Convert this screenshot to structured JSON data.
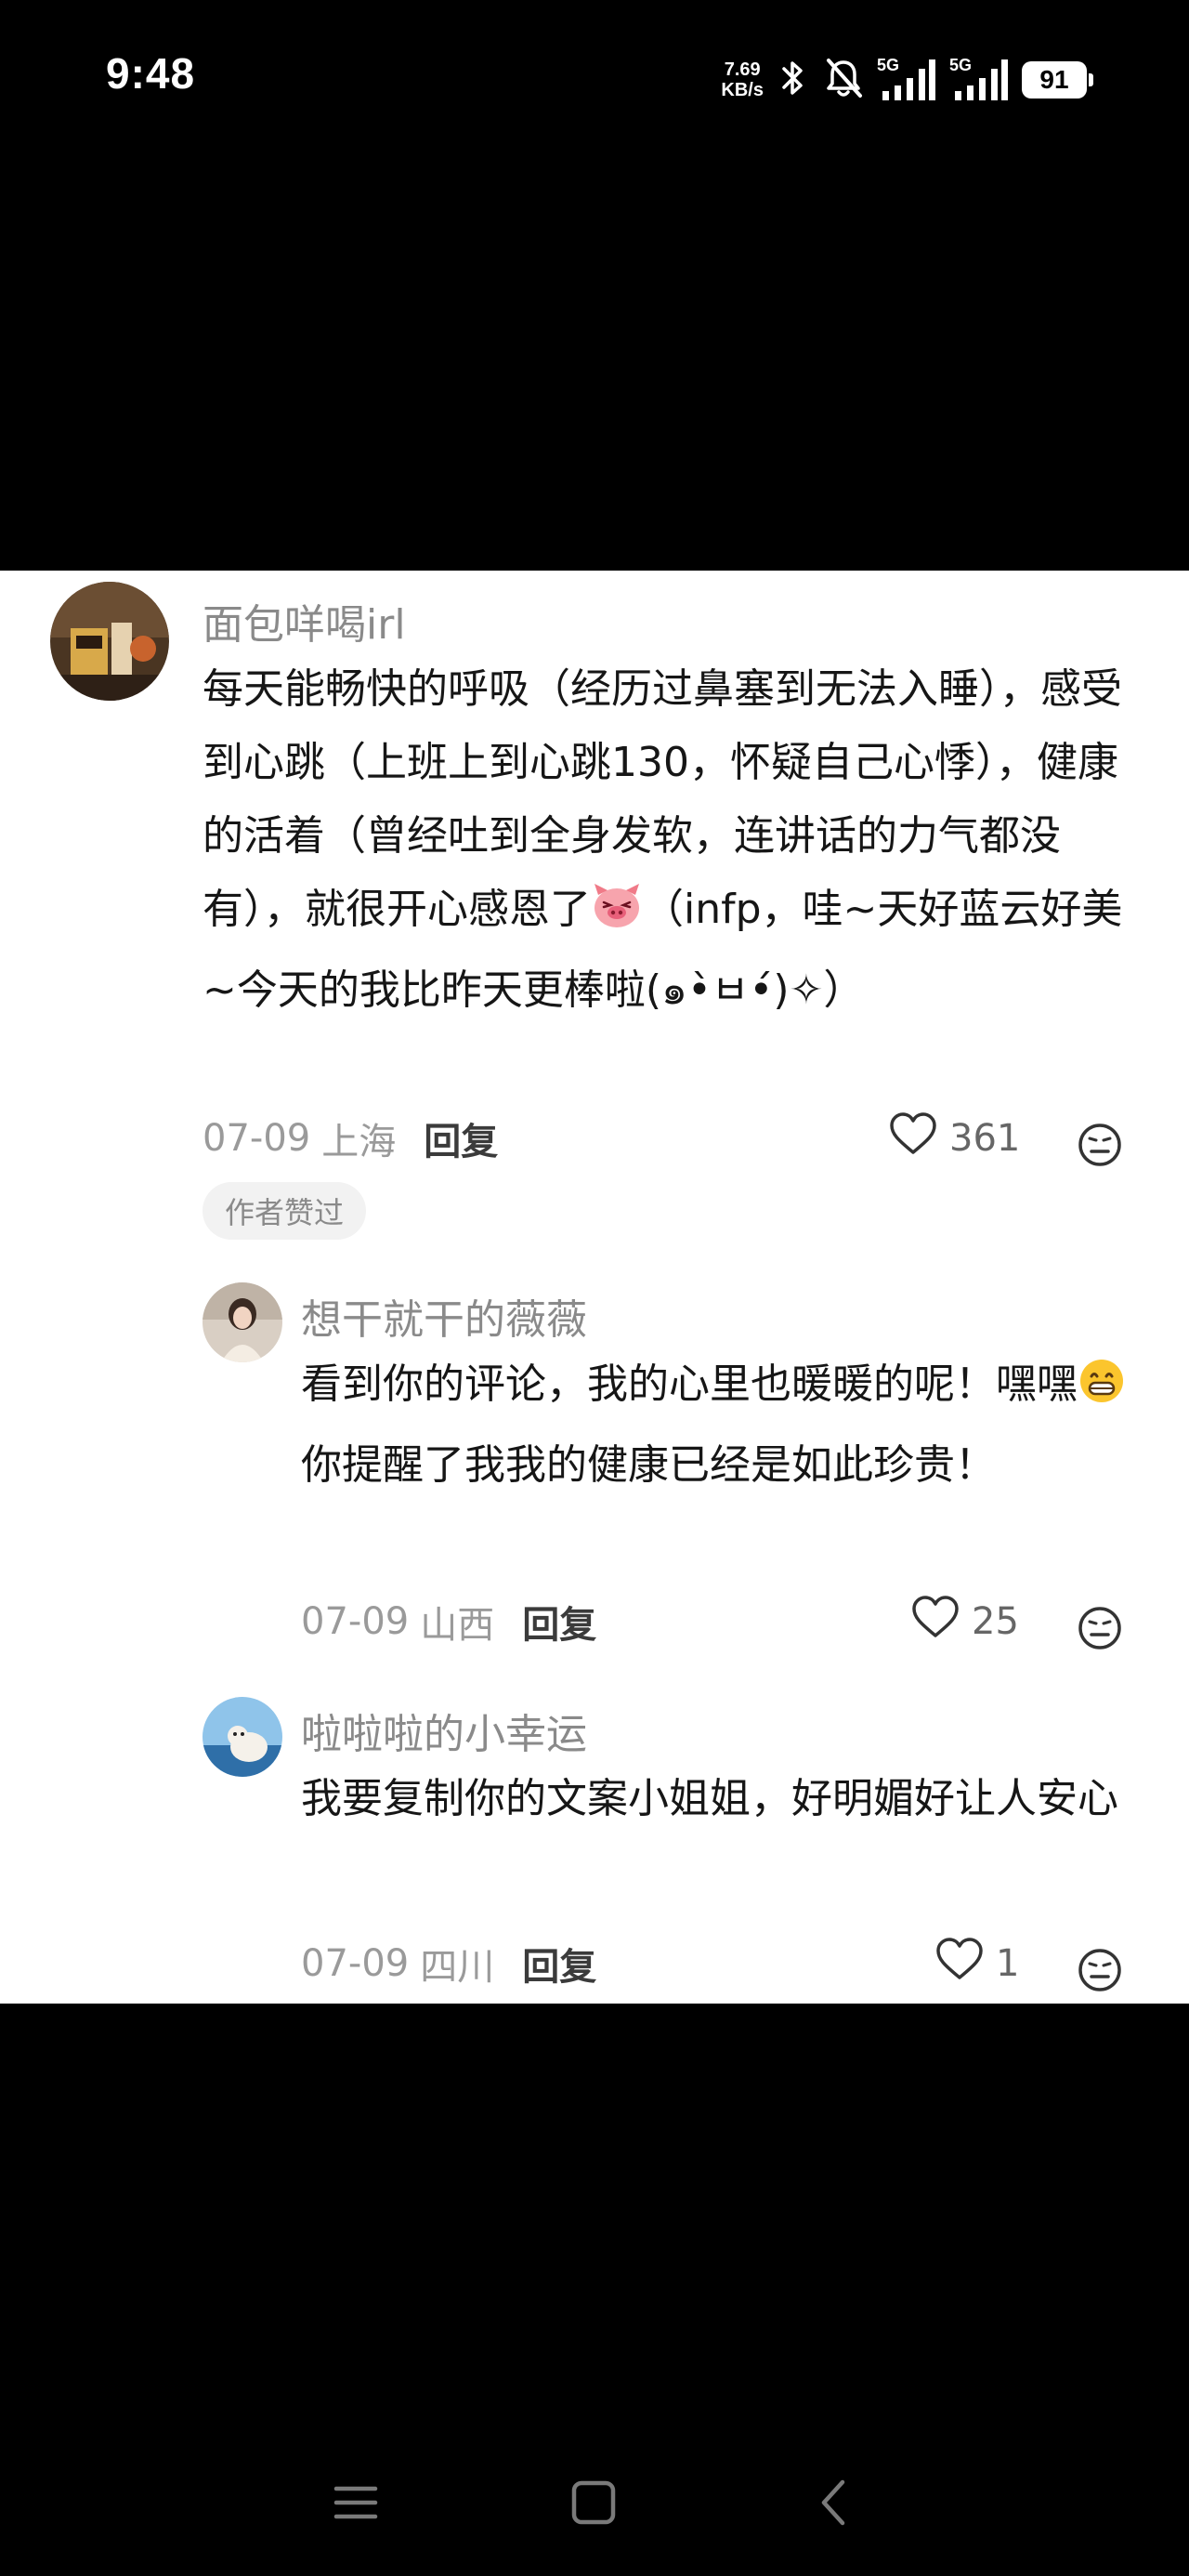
{
  "status_bar": {
    "time": "9:48",
    "net_speed_value": "7.69",
    "net_speed_unit": "KB/s",
    "sim1_label": "5G",
    "sim2_label": "5G",
    "battery": "91"
  },
  "comments": [
    {
      "username": "面包咩喝irl",
      "text_before_emoji": "每天能畅快的呼吸（经历过鼻塞到无法入睡），感受到心跳（上班上到心跳130，怀疑自己心悸），健康的活着（曾经吐到全身发软，连讲话的力气都没有），就很开心感恩了",
      "text_after_emoji": "（infp，哇~天好蓝云好美~今天的我比昨天更棒啦(๑•̀ㅂ•́)✧）",
      "date": "07-09",
      "location": "上海",
      "reply_label": "回复",
      "likes": "361",
      "author_tag": "作者赞过"
    },
    {
      "username": "想干就干的薇薇",
      "text_before_emoji": "看到你的评论，我的心里也暖暖的呢！嘿嘿",
      "text_after_emoji": "你提醒了我我的健康已经是如此珍贵！",
      "date": "07-09",
      "location": "山西",
      "reply_label": "回复",
      "likes": "25"
    },
    {
      "username": "啦啦啦的小幸运",
      "text": "我要复制你的文案小姐姐，好明媚好让人安心",
      "date": "07-09",
      "location": "四川",
      "reply_label": "回复",
      "likes": "1"
    }
  ],
  "nav_bar": {
    "icons": [
      "menu-icon",
      "home-square-icon",
      "back-chevron-icon"
    ]
  }
}
